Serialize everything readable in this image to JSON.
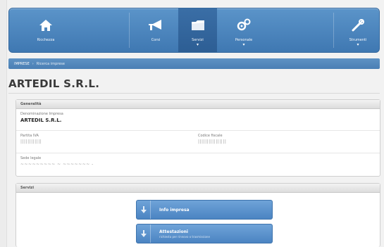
{
  "nav": {
    "items": [
      {
        "label": "Ricchezza",
        "icon": "home-icon",
        "active": false,
        "caret": false
      },
      {
        "label": "Corsi",
        "icon": "megaphone-icon",
        "active": false,
        "caret": false
      },
      {
        "label": "Servizi",
        "icon": "folder-icon",
        "active": true,
        "caret": true
      },
      {
        "label": "Personale",
        "icon": "gears-icon",
        "active": false,
        "caret": true
      },
      {
        "label": "Strumenti",
        "icon": "tools-icon",
        "active": false,
        "caret": true
      }
    ],
    "caret_glyph": "▾"
  },
  "breadcrumb": {
    "root": "IMPRESE",
    "separator": "›",
    "current": "Ricerca imprese"
  },
  "page": {
    "title": "ARTEDIL S.R.L."
  },
  "generalita": {
    "heading": "Generalità",
    "denominazione_label": "Denominazione Impresa",
    "denominazione_value": "ARTEDIL S.R.L.",
    "partita_iva_label": "Partita IVA",
    "partita_iva_value": "||||||||||||",
    "codice_fiscale_label": "Codice fiscale",
    "codice_fiscale_value": "||||||||||||||||",
    "sede_label": "Sede legale",
    "sede_value": "~~~~~~~~~ ~ ~~~~~~~ -"
  },
  "servizi": {
    "heading": "Servizi",
    "buttons": [
      {
        "title": "Info impresa",
        "subtitle": ""
      },
      {
        "title": "Attestazioni",
        "subtitle": "richiesta per rinnovo o trasmissione"
      }
    ]
  },
  "colors": {
    "nav": "#4a82bd",
    "accent": "#5e92c4"
  }
}
